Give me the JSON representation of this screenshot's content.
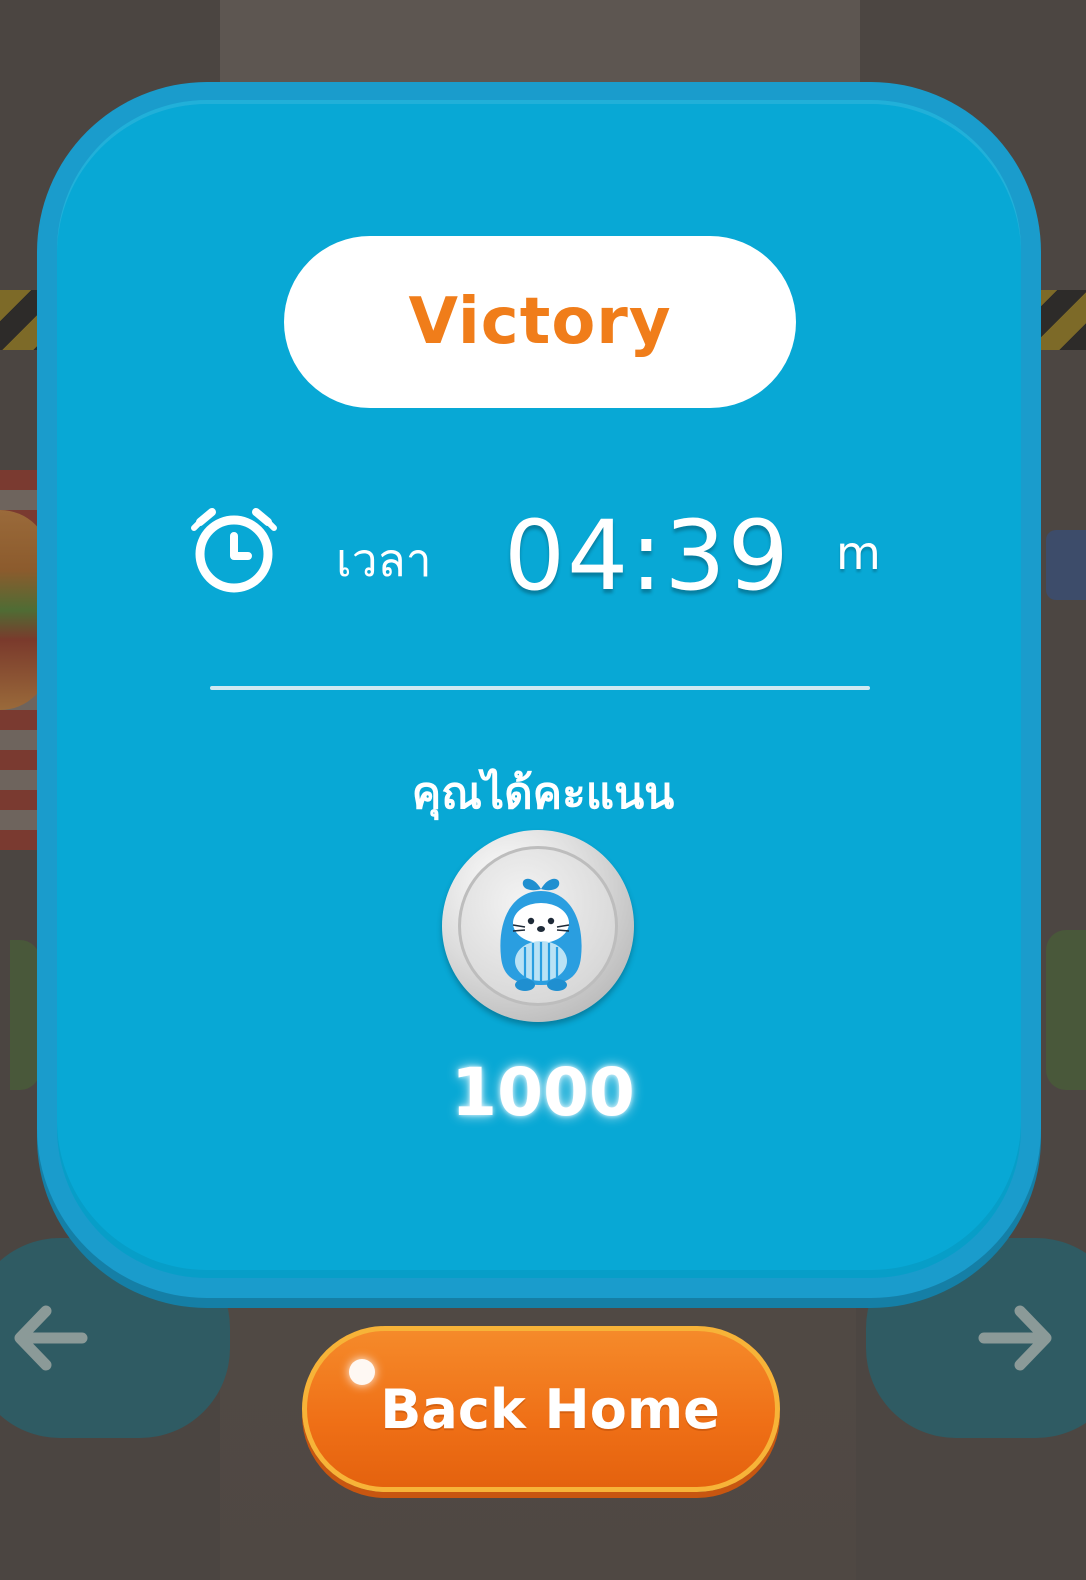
{
  "dialog": {
    "title": "Victory",
    "time_label": "เวลา",
    "time_value": "04:39",
    "time_unit": "m",
    "score_label": "คุณได้คะแนน",
    "score_value": "1000"
  },
  "buttons": {
    "back_home": "Back Home"
  },
  "icons": {
    "clock": "stopwatch-icon",
    "coin": "coin-mascot-icon",
    "nav_left": "arrow-left-icon",
    "nav_right": "arrow-right-icon"
  },
  "colors": {
    "panel": "#08a8d5",
    "panel_border": "#1a9ccc",
    "title_text": "#f07d1a",
    "button": "#ef6f16",
    "button_border": "#f7b338"
  }
}
